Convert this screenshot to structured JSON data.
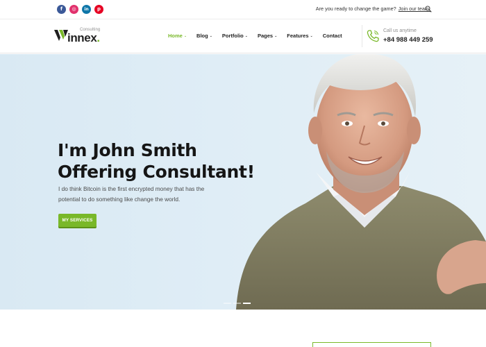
{
  "topbar": {
    "social_icons": [
      {
        "name": "facebook-icon",
        "glyph": "f",
        "color": "#3b5998"
      },
      {
        "name": "instagram-icon",
        "glyph": "◎",
        "color": "#e1306c"
      },
      {
        "name": "linkedin-icon",
        "glyph": "in",
        "color": "#0e76a8"
      },
      {
        "name": "pinterest-icon",
        "glyph": "p",
        "color": "#e60023"
      }
    ],
    "prompt_text": "Are you ready to change the game?",
    "join_link": "Join our team."
  },
  "header": {
    "logo": {
      "tagline": "Consulting",
      "word": "innex",
      "dot": "."
    },
    "nav": [
      {
        "label": "Home",
        "active": true,
        "has_caret": true
      },
      {
        "label": "Blog",
        "active": false,
        "has_caret": true
      },
      {
        "label": "Portfolio",
        "active": false,
        "has_caret": true
      },
      {
        "label": "Pages",
        "active": false,
        "has_caret": true
      },
      {
        "label": "Features",
        "active": false,
        "has_caret": true
      },
      {
        "label": "Contact",
        "active": false,
        "has_caret": false
      }
    ],
    "call_label": "Call us anytime",
    "call_number": "+84 988 449 259"
  },
  "hero": {
    "title_line1": "I'm John Smith",
    "title_line2": "Offering Consultant!",
    "desc_line1": "I do think Bitcoin is the first encrypted money that has the",
    "desc_line2": "potential to do something like change the world.",
    "button_label": "MY SERVICES",
    "slides_count": 3,
    "active_slide": 3
  },
  "colors": {
    "accent": "#79b829",
    "hero_bg": "#dfedf6",
    "text_dark": "#151515"
  }
}
